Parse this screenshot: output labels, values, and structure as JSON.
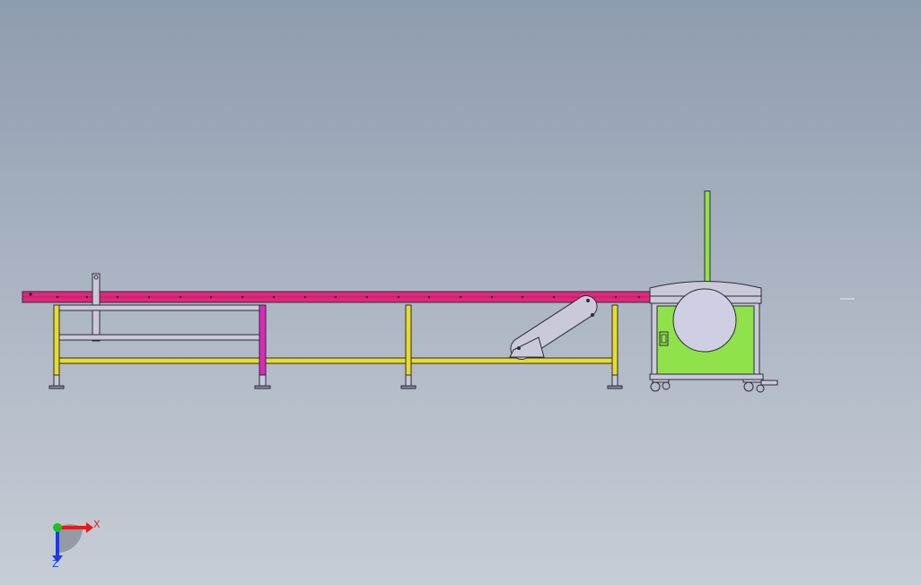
{
  "viewport": {
    "background_top": "#8e9caf",
    "background_bottom": "#c7cdd6"
  },
  "colors": {
    "conveyor_top": "#e0287a",
    "frame_yellow": "#e8dc28",
    "leg_magenta": "#d92ab8",
    "machine_green": "#8fe24a",
    "machine_body": "#c9c9d9",
    "blade_disc": "#cfcfe3",
    "outline": "#2b2b3a",
    "axis_x": "#e31b1b",
    "axis_y": "#19c41e",
    "axis_z": "#1b3be3"
  },
  "triad": {
    "x_label": "X",
    "z_label": "Z"
  }
}
